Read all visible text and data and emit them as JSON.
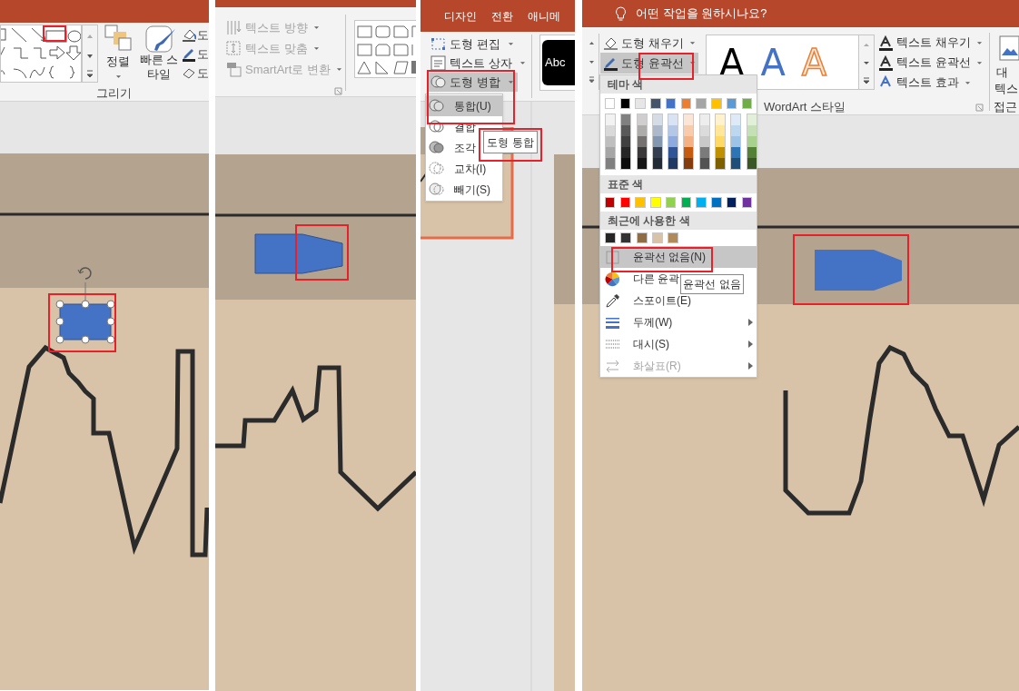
{
  "panel_1": {
    "ribbon": {
      "arrange_label": "정렬",
      "quick_styles_label": "빠른 스타일",
      "side_buttons": [
        "도",
        "도",
        "도"
      ],
      "group_label": "그리기"
    },
    "slide": {
      "shape_selected": true
    }
  },
  "panel_2": {
    "ribbon": {
      "commands": [
        {
          "label": "텍스트 방향",
          "disabled": true
        },
        {
          "label": "텍스트 맞춤",
          "disabled": true
        },
        {
          "label": "SmartArt로 변환",
          "disabled": true
        }
      ]
    }
  },
  "panel_3": {
    "tabs": [
      "디자인",
      "전환",
      "애니메"
    ],
    "commands": [
      {
        "label": "도형 편집",
        "highlighted": false
      },
      {
        "label": "텍스트 상자",
        "highlighted": false
      },
      {
        "label": "도형 병합",
        "highlighted": true
      }
    ],
    "style_preview": "Abc",
    "merge_menu": {
      "items": [
        {
          "label": "통합(U)",
          "highlighted": true
        },
        {
          "label": "결합",
          "highlighted": false
        },
        {
          "label": "조각",
          "highlighted": false
        },
        {
          "label": "교차(I)",
          "highlighted": false
        },
        {
          "label": "빼기(S)",
          "highlighted": false
        }
      ],
      "tooltip": "도형 통합"
    }
  },
  "panel_4": {
    "search_placeholder": "어떤 작업을 원하시나요?",
    "commands": [
      {
        "label": "도형 채우기",
        "highlighted": false
      },
      {
        "label": "도형 윤곽선",
        "highlighted": true
      }
    ],
    "wordart_samples": [
      {
        "text": "A",
        "kind": "solid"
      },
      {
        "text": "A",
        "kind": "blue"
      },
      {
        "text": "A",
        "kind": "outline"
      }
    ],
    "text_commands": [
      "텍스트 채우기",
      "텍스트 윤곽선",
      "텍스트 효과"
    ],
    "group_label": "WordArt 스타일",
    "cut_labels": [
      "대",
      "텍스",
      "접근"
    ],
    "outline_menu": {
      "theme_heading": "테마 색",
      "theme_colors": [
        {
          "color": "#ffffff",
          "shades": [
            {
              "color": "#f2f2f2"
            },
            {
              "color": "#d9d9d9"
            },
            {
              "color": "#bfbfbf"
            },
            {
              "color": "#a6a6a6"
            },
            {
              "color": "#808080"
            }
          ]
        },
        {
          "color": "#000000",
          "shades": [
            {
              "color": "#808080"
            },
            {
              "color": "#595959"
            },
            {
              "color": "#404040"
            },
            {
              "color": "#262626"
            },
            {
              "color": "#0d0d0d"
            }
          ]
        },
        {
          "color": "#e7e6e6",
          "shades": [
            {
              "color": "#d0cece"
            },
            {
              "color": "#aeabab"
            },
            {
              "color": "#757171"
            },
            {
              "color": "#3a3838"
            },
            {
              "color": "#171616"
            }
          ]
        },
        {
          "color": "#44546a",
          "shades": [
            {
              "color": "#d6dce5"
            },
            {
              "color": "#adb9ca"
            },
            {
              "color": "#8497b0"
            },
            {
              "color": "#333f50"
            },
            {
              "color": "#222a35"
            }
          ]
        },
        {
          "color": "#4472c4",
          "shades": [
            {
              "color": "#dae3f3"
            },
            {
              "color": "#b4c7e7"
            },
            {
              "color": "#8faadc"
            },
            {
              "color": "#2f5597"
            },
            {
              "color": "#203864"
            }
          ]
        },
        {
          "color": "#ed7d31",
          "shades": [
            {
              "color": "#fbe5d6"
            },
            {
              "color": "#f8cbad"
            },
            {
              "color": "#f4b183"
            },
            {
              "color": "#c55a11"
            },
            {
              "color": "#843c0c"
            }
          ]
        },
        {
          "color": "#a5a5a5",
          "shades": [
            {
              "color": "#ededed"
            },
            {
              "color": "#dbdbdb"
            },
            {
              "color": "#c9c9c9"
            },
            {
              "color": "#7b7b7b"
            },
            {
              "color": "#525252"
            }
          ]
        },
        {
          "color": "#ffc000",
          "shades": [
            {
              "color": "#fff2cc"
            },
            {
              "color": "#ffe699"
            },
            {
              "color": "#ffd966"
            },
            {
              "color": "#bf9000"
            },
            {
              "color": "#7f6000"
            }
          ]
        },
        {
          "color": "#5b9bd5",
          "shades": [
            {
              "color": "#deebf7"
            },
            {
              "color": "#bdd7ee"
            },
            {
              "color": "#9dc3e6"
            },
            {
              "color": "#2e75b6"
            },
            {
              "color": "#1f4e79"
            }
          ]
        },
        {
          "color": "#70ad47",
          "shades": [
            {
              "color": "#e2f0d9"
            },
            {
              "color": "#c5e0b4"
            },
            {
              "color": "#a9d18e"
            },
            {
              "color": "#548235"
            },
            {
              "color": "#385723"
            }
          ]
        }
      ],
      "standard_heading": "표준 색",
      "standard_colors": [
        {
          "color": "#c00000"
        },
        {
          "color": "#ff0000"
        },
        {
          "color": "#ffc000"
        },
        {
          "color": "#ffff00"
        },
        {
          "color": "#92d050"
        },
        {
          "color": "#00b050"
        },
        {
          "color": "#00b0f0"
        },
        {
          "color": "#0070c0"
        },
        {
          "color": "#002060"
        },
        {
          "color": "#7030a0"
        }
      ],
      "recent_heading": "최근에 사용한 색",
      "recent_colors": [
        {
          "color": "#262626"
        },
        {
          "color": "#333333"
        },
        {
          "color": "#8f6d45"
        },
        {
          "color": "#d9c3a8"
        },
        {
          "color": "#b08a5a"
        }
      ],
      "items": [
        {
          "kind": "none",
          "label": "윤곽선 없음(N)",
          "highlighted": true,
          "submenu": false,
          "disabled": false
        },
        {
          "kind": "more",
          "label": "다른 윤곽",
          "highlighted": false,
          "submenu": false,
          "disabled": false
        },
        {
          "kind": "eyedropper",
          "label": "스포이트(E)",
          "highlighted": false,
          "submenu": false,
          "disabled": false
        },
        {
          "kind": "weight",
          "label": "두께(W)",
          "highlighted": false,
          "submenu": true,
          "disabled": false
        },
        {
          "kind": "dash",
          "label": "대시(S)",
          "highlighted": false,
          "submenu": true,
          "disabled": false
        },
        {
          "kind": "arrows",
          "label": "화살표(R)",
          "highlighted": false,
          "submenu": true,
          "disabled": true
        }
      ],
      "tooltip": "윤곽선 없음"
    }
  }
}
